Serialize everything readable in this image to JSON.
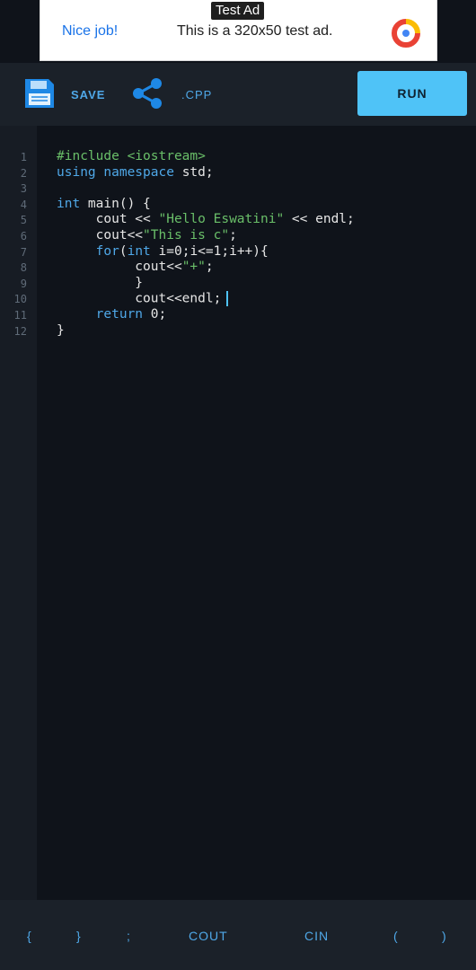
{
  "ad": {
    "tag": "Test Ad",
    "title": "Nice job!",
    "text": "This is a 320x50 test ad."
  },
  "toolbar": {
    "save_label": "SAVE",
    "file_type_label": ".CPP",
    "run_label": "RUN"
  },
  "editor": {
    "line_numbers": [
      "1",
      "2",
      "3",
      "4",
      "5",
      "6",
      "7",
      "8",
      "9",
      "10",
      "11",
      "12"
    ],
    "lines": [
      {
        "indent": "",
        "text": "#include <iostream>"
      },
      {
        "indent": "",
        "text": "using namespace std;"
      },
      {
        "indent": "",
        "text": ""
      },
      {
        "indent": "",
        "text": "int main() {"
      },
      {
        "indent": "     ",
        "text": "cout << \"Hello Eswatini\" << endl;"
      },
      {
        "indent": "     ",
        "text": "cout<<\"This is c\";"
      },
      {
        "indent": "     ",
        "text": "for(int i=0;i<=1;i++){"
      },
      {
        "indent": "          ",
        "text": "cout<<\"+\";"
      },
      {
        "indent": "          ",
        "text": "}"
      },
      {
        "indent": "          ",
        "text": "cout<<endl;"
      },
      {
        "indent": "     ",
        "text": "return 0;"
      },
      {
        "indent": "",
        "text": "}"
      }
    ]
  },
  "keybar": {
    "keys": [
      "{",
      "}",
      ";",
      "COUT",
      "CIN",
      "(",
      ")"
    ]
  },
  "colors": {
    "accent": "#4fc3f7",
    "keyword": "#4fa8e8",
    "string": "#6abf69",
    "background": "#0f131a",
    "toolbar": "#1b2129"
  }
}
